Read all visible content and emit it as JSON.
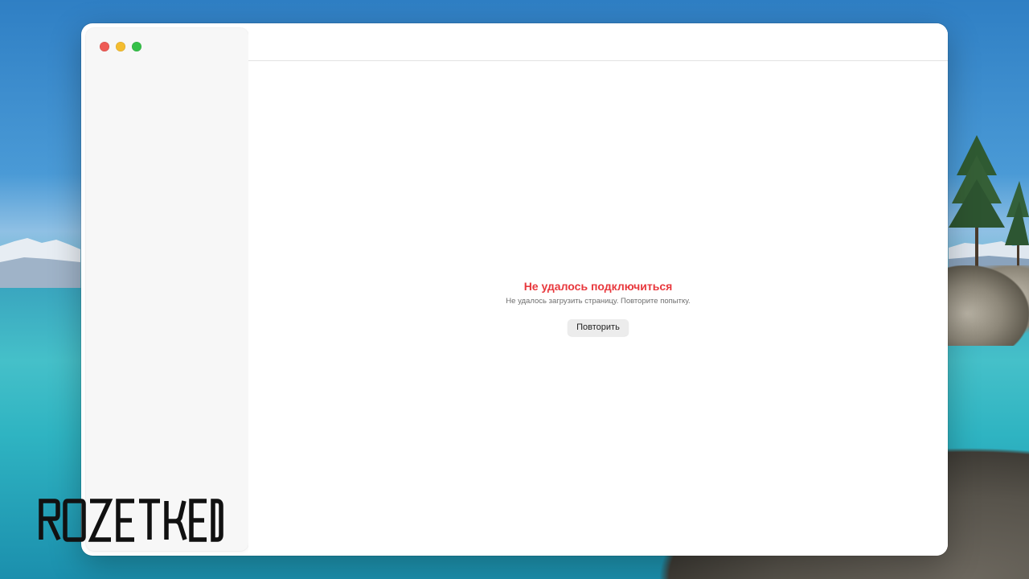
{
  "window": {
    "traffic_lights": [
      {
        "name": "close",
        "color": "#ee5b55"
      },
      {
        "name": "minimize",
        "color": "#f4bd30"
      },
      {
        "name": "zoom",
        "color": "#35c048"
      }
    ]
  },
  "error": {
    "title": "Не удалось подключиться",
    "message": "Не удалось загрузить страницу. Повторите попытку.",
    "retry_label": "Повторить",
    "title_color": "#e8383d"
  },
  "watermark": {
    "logo_text": "ROZETKED"
  }
}
